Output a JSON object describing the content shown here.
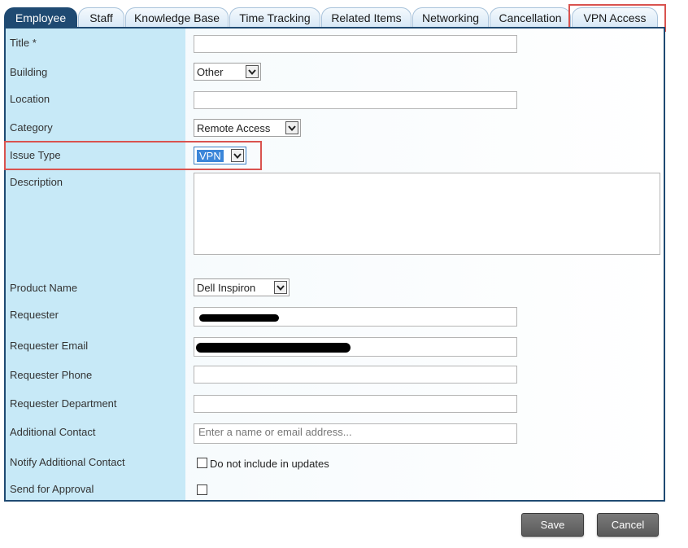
{
  "tabs": [
    {
      "label": "Employee",
      "active": true
    },
    {
      "label": "Staff"
    },
    {
      "label": "Knowledge Base"
    },
    {
      "label": "Time Tracking"
    },
    {
      "label": "Related Items"
    },
    {
      "label": "Networking"
    },
    {
      "label": "Cancellation"
    },
    {
      "label": "VPN Access"
    }
  ],
  "form": {
    "title_label": "Title *",
    "building_label": "Building",
    "building_value": "Other",
    "location_label": "Location",
    "category_label": "Category",
    "category_value": "Remote Access",
    "issue_type_label": "Issue Type",
    "issue_type_value": "VPN",
    "description_label": "Description",
    "product_name_label": "Product Name",
    "product_name_value": "Dell Inspiron",
    "requester_label": "Requester",
    "requester_email_label": "Requester Email",
    "requester_phone_label": "Requester Phone",
    "requester_department_label": "Requester Department",
    "additional_contact_label": "Additional Contact",
    "additional_contact_placeholder": "Enter a name or email address...",
    "notify_label": "Notify Additional Contact",
    "notify_checkbox_text": "Do not include in updates",
    "approval_label": "Send for Approval"
  },
  "buttons": {
    "save": "Save",
    "cancel": "Cancel"
  },
  "colors": {
    "accent": "#1f4a72",
    "label_column": "#c7e9f7",
    "highlight": "#d9534f",
    "button": "#6a6a6a"
  }
}
